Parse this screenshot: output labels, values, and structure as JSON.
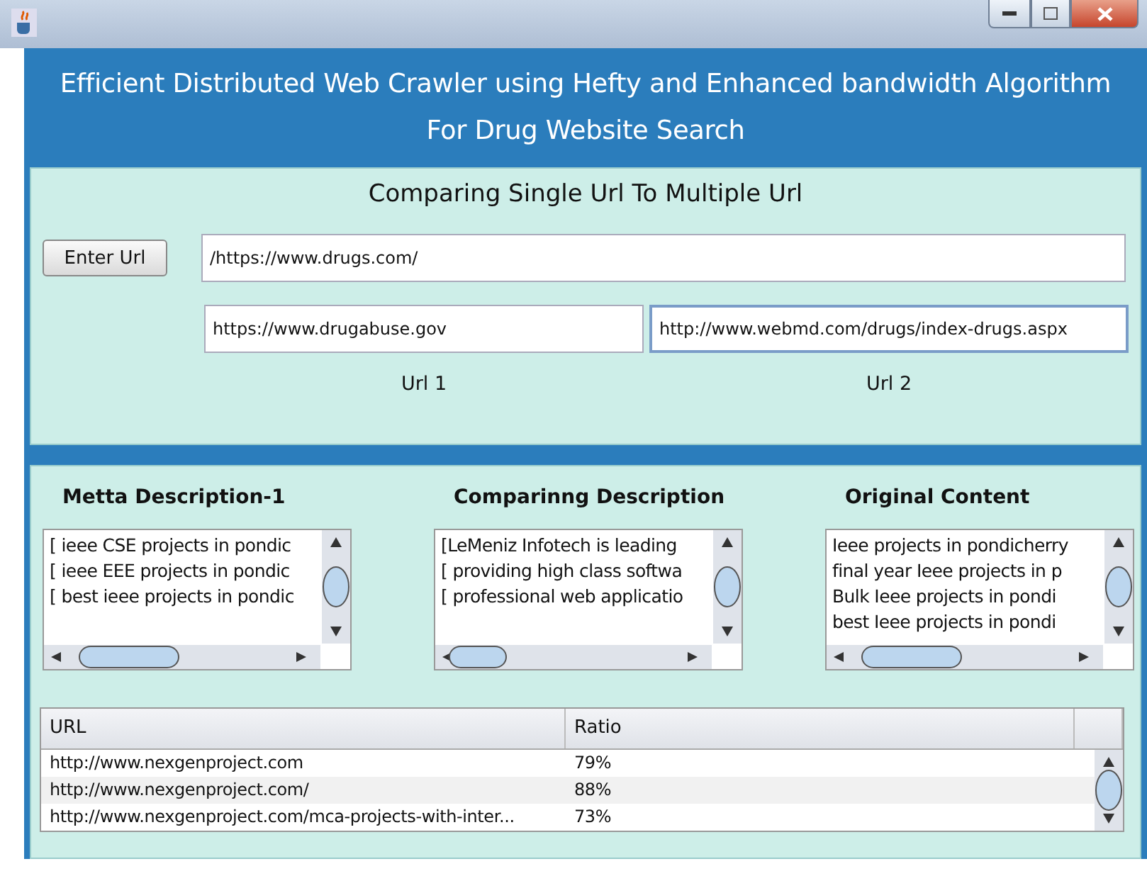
{
  "window": {
    "title_lines": [
      "Efficient Distributed Web Crawler using Hefty and Enhanced bandwidth Algorithm",
      "For Drug Website Search"
    ]
  },
  "compare_panel": {
    "heading": "Comparing Single Url To Multiple Url",
    "button": "Enter Url",
    "main_field": {
      "value": "/https://www.drugs.com/",
      "focused": false
    },
    "fields": [
      {
        "value": "https://www.drugabuse.gov",
        "focused": false,
        "label": "Url 1"
      },
      {
        "value": "http://www.webmd.com/drugs/index-drugs.aspx",
        "focused": true,
        "label": "Url 2"
      }
    ]
  },
  "descriptions": [
    {
      "heading": "Metta Description-1",
      "lines": [
        "[ ieee CSE projects in pondic",
        "[ ieee EEE projects in pondic",
        "[ best ieee projects in pondic"
      ]
    },
    {
      "heading": "Comparinng Description",
      "lines": [
        "[LeMeniz Infotech is leading",
        "[ providing high class softwa",
        "[ professional web applicatio"
      ]
    },
    {
      "heading": "Original Content",
      "lines": [
        "Ieee projects in pondicherry",
        "final year Ieee projects in p",
        "Bulk Ieee projects in pondi",
        "best Ieee projects in pondi"
      ]
    }
  ],
  "table": {
    "columns": [
      "URL",
      "Ratio"
    ],
    "rows": [
      [
        "http://www.nexgenproject.com",
        "79%"
      ],
      [
        "http://www.nexgenproject.com/",
        "88%"
      ],
      [
        "http://www.nexgenproject.com/mca-projects-with-inter...",
        "73%"
      ]
    ]
  }
}
